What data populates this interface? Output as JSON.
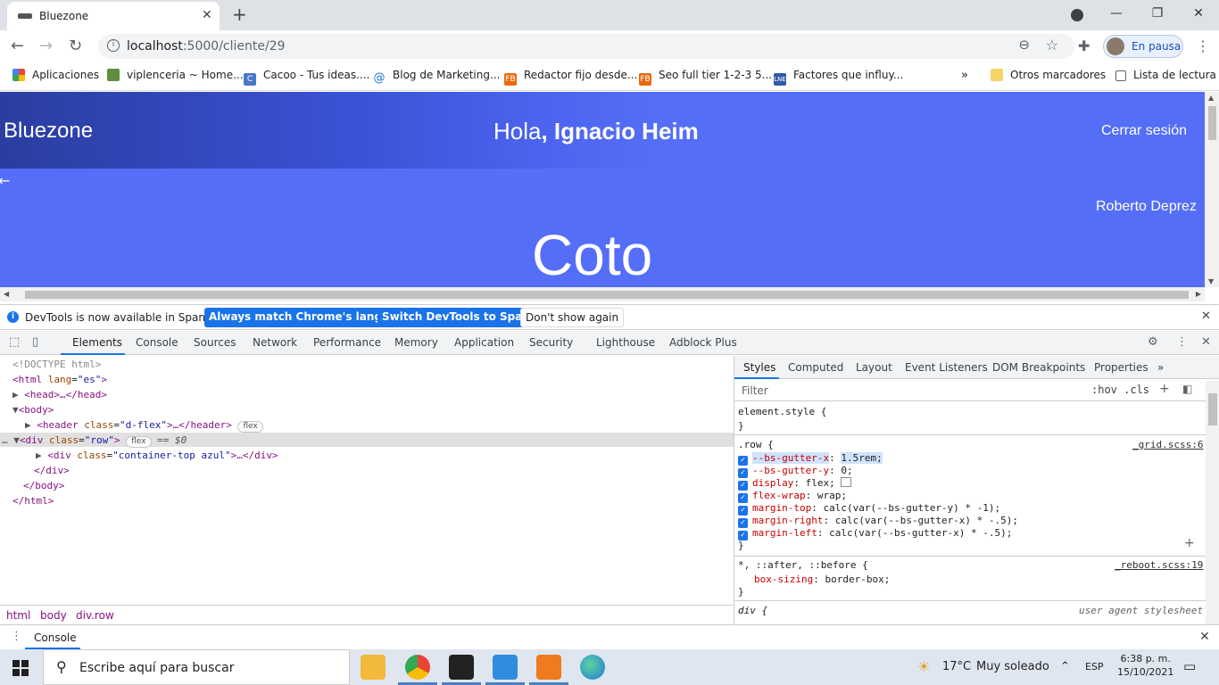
{
  "browser": {
    "tab_title": "Bluezone",
    "url_host": "localhost",
    "url_path": ":5000/cliente/29",
    "profile_label": "En pausa"
  },
  "bookmarks": [
    {
      "label": "Aplicaciones",
      "color": "#e8453c"
    },
    {
      "label": "viplenceria ~ Home...",
      "color": "#5e8e3e"
    },
    {
      "label": "Cacoo - Tus ideas....",
      "color": "#4a78c8"
    },
    {
      "label": "Blog de Marketing...",
      "color": "#1a73e8"
    },
    {
      "label": "Redactor fijo desde...",
      "color": "#e86a10"
    },
    {
      "label": "Seo full tier 1-2-3 5...",
      "color": "#e86a10"
    },
    {
      "label": "Factores que influy...",
      "color": "#2f5aa8"
    }
  ],
  "bookmarks_overflow": "»",
  "bookmarks_right": [
    "Otros marcadores",
    "Lista de lectura"
  ],
  "site": {
    "brand": "Bluezone",
    "greeting_prefix": "Hola",
    "greeting_name": ", Ignacio Heim",
    "logout": "Cerrar sesión",
    "client_name": "Roberto Deprez",
    "company": "Coto"
  },
  "devtools": {
    "info_message": "DevTools is now available in Spanish!",
    "btn_match": "Always match Chrome's language",
    "btn_switch": "Switch DevTools to Spanish",
    "btn_dont": "Don't show again",
    "tabs": [
      "Elements",
      "Console",
      "Sources",
      "Network",
      "Performance",
      "Memory",
      "Application",
      "Security",
      "Lighthouse",
      "Adblock Plus"
    ],
    "active_tab": "Elements",
    "dom": {
      "doctype": "<!DOCTYPE html>",
      "html_open": "<html",
      "lang_attr": "lang",
      "lang_val": "\"es\"",
      "head": "<head>…</head>",
      "body_open": "<body>",
      "header_tag": "<header",
      "header_class_val": "\"d-flex\"",
      "header_close": ">…</header>",
      "div_tag": "<div",
      "row_val": "\"row\"",
      "selected_suffix": "== $0",
      "inner_div_tag": "<div",
      "inner_class_val": "\"container-top azul\"",
      "inner_close": ">…</div>",
      "div_close": "</div>",
      "body_close": "</body>",
      "html_close": "</html>",
      "class_attr": "class",
      "badge": "flex"
    },
    "breadcrumbs": [
      "html",
      "body",
      "div.row"
    ],
    "styles_tabs": [
      "Styles",
      "Computed",
      "Layout",
      "Event Listeners",
      "DOM Breakpoints",
      "Properties"
    ],
    "filter_placeholder": "Filter",
    "filter_options": ":hov  .cls",
    "element_style": "element.style {",
    "rule_row_selector": ".row {",
    "rule_row_source": "_grid.scss:6",
    "row_props": [
      {
        "name": "--bs-gutter-x",
        "value": "1.5rem;"
      },
      {
        "name": "--bs-gutter-y",
        "value": "0;"
      },
      {
        "name": "display",
        "value": "flex;"
      },
      {
        "name": "flex-wrap",
        "value": "wrap;"
      },
      {
        "name": "margin-top",
        "value": "calc(var(--bs-gutter-y) * -1);"
      },
      {
        "name": "margin-right",
        "value": "calc(var(--bs-gutter-x) * -.5);"
      },
      {
        "name": "margin-left",
        "value": "calc(var(--bs-gutter-x) * -.5);"
      }
    ],
    "rule_all_selector": "*, ::after, ::before {",
    "rule_all_source": "_reboot.scss:19",
    "rule_all_prop": "box-sizing",
    "rule_all_value": "border-box;",
    "rule_div_selector": "div {",
    "rule_div_source": "user agent stylesheet",
    "close_brace": "}",
    "drawer_tab": "Console"
  },
  "taskbar": {
    "search_placeholder": "Escribe aquí para buscar",
    "weather_temp": "17°C",
    "weather_text": "Muy soleado",
    "lang": "ESP",
    "time": "6:38 p. m.",
    "date": "15/10/2021"
  }
}
